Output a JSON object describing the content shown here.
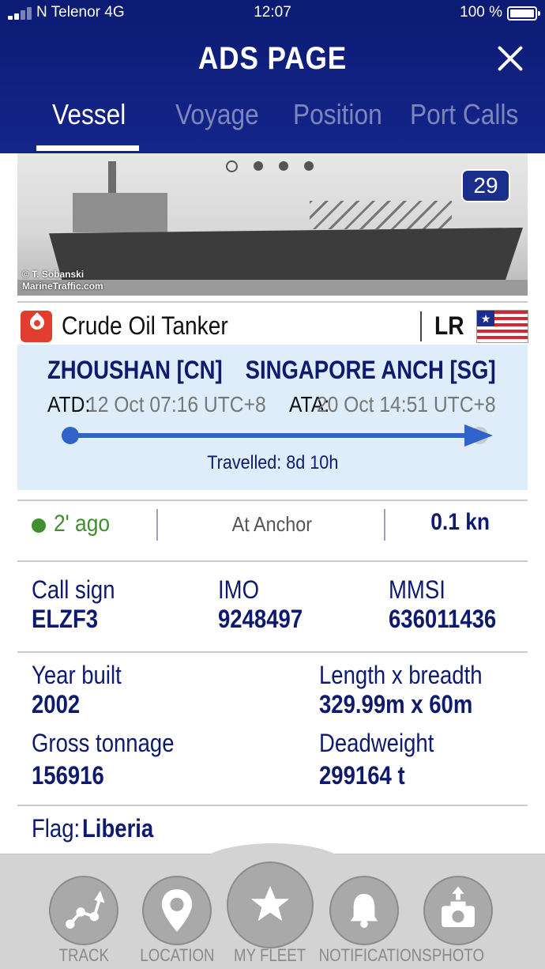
{
  "status_bar": {
    "carrier": "N Telenor 4G",
    "time": "12:07",
    "battery": "100 %"
  },
  "header": {
    "title": "ADS PAGE",
    "tabs": [
      {
        "label": "Vessel",
        "active": true
      },
      {
        "label": "Voyage",
        "active": false
      },
      {
        "label": "Position",
        "active": false
      },
      {
        "label": "Port Calls",
        "active": false
      }
    ]
  },
  "photo": {
    "count": "29",
    "credit_line1": "© T. Sobanski",
    "credit_line2": "MarineTraffic.com",
    "slide_count": 4,
    "active_slide": 0
  },
  "vessel_type": {
    "label": "Crude Oil Tanker",
    "flag_code": "LR",
    "icon": "oil-drop-icon"
  },
  "voyage": {
    "from_port": "ZHOUSHAN [CN]",
    "to_port": "SINGAPORE ANCH [SG]",
    "atd_label": "ATD:",
    "atd_value": "12 Oct 07:16 UTC+8",
    "ata_label": "ATA:",
    "ata_value": "20 Oct 14:51 UTC+8",
    "travelled": "Travelled: 8d 10h"
  },
  "status": {
    "ago": "2' ago",
    "nav_status": "At Anchor",
    "speed": "0.1 kn"
  },
  "identity": {
    "call_sign_label": "Call sign",
    "call_sign": "ELZF3",
    "imo_label": "IMO",
    "imo": "9248497",
    "mmsi_label": "MMSI",
    "mmsi": "636011436"
  },
  "specs": {
    "year_built_label": "Year built",
    "year_built": "2002",
    "length_label": "Length x breadth",
    "length": "329.99m x 60m",
    "gross_label": "Gross tonnage",
    "gross": "156916",
    "deadweight_label": "Deadweight",
    "deadweight": "299164 t"
  },
  "flag": {
    "label": "Flag:",
    "value": "Liberia"
  },
  "bottom_nav": [
    {
      "label": "TRACK",
      "icon": "track-icon"
    },
    {
      "label": "LOCATION",
      "icon": "location-pin-icon"
    },
    {
      "label": "MY FLEET",
      "icon": "star-icon"
    },
    {
      "label": "NOTIFICATIONS",
      "icon": "bell-icon"
    },
    {
      "label": "PHOTO",
      "icon": "camera-upload-icon"
    }
  ],
  "colors": {
    "header": "#0c1b73",
    "accent": "#0d1a6e",
    "route": "#2f63c9",
    "online": "#3f8f2e",
    "type_icon": "#e23e2e"
  }
}
